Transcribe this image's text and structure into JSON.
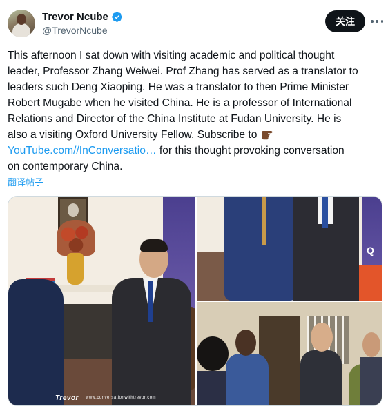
{
  "author": {
    "display_name": "Trevor Ncube",
    "handle": "@TrevorNcube",
    "verified_icon": "verified-badge-icon"
  },
  "actions": {
    "follow_label": "关注",
    "more_icon": "more-options-icon"
  },
  "tweet": {
    "lines": [
      "This afternoon I sat down with visiting academic and political thought",
      "leader, Professor Zhang Weiwei. Prof Zhang has served as a translator to",
      "leaders such Deng Xiaoping. He was a translator to then Prime Minister",
      "Robert Mugabe when he visited China. He is a professor of International",
      "Relations and Director of the China Institute at Fudan University. He is",
      "also a visiting Oxford University Fellow. Subscribe to"
    ],
    "link_text": "YouTube.com//InConversatio…",
    "after_link": " for this thought provoking conversation",
    "last_line": "on contemporary China.",
    "pointing_icon": "backhand-index-pointing-right-icon"
  },
  "translate_label": "翻译帖子",
  "media": {
    "photo_1_watermark": "Trevor",
    "photo_1_url_watermark": "www.conversationwithtrevor.com",
    "photo_2_watermark": "Q"
  },
  "colors": {
    "link": "#1d9bf0",
    "text": "#0f1419",
    "secondary": "#536471",
    "follow_bg": "#0f1419"
  }
}
